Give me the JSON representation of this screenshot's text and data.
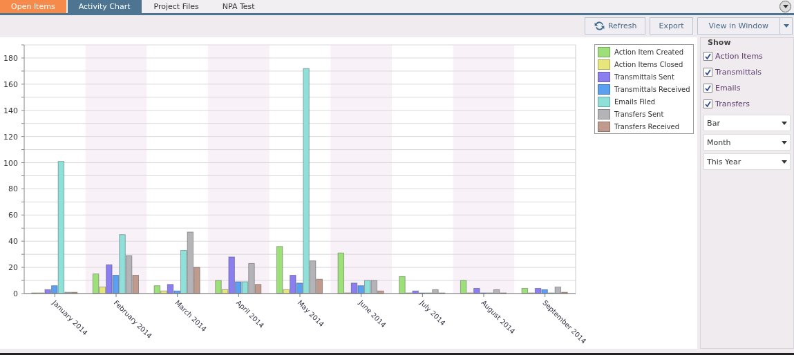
{
  "tabs": [
    {
      "label": "Open Items",
      "selected": false,
      "color": "#f58a4b"
    },
    {
      "label": "Activity Chart",
      "selected": true
    },
    {
      "label": "Project Files",
      "selected": false
    },
    {
      "label": "NPA Test",
      "selected": false
    }
  ],
  "toolbar": {
    "buttons": [
      {
        "label": "Refresh",
        "kind": "refresh"
      },
      {
        "label": "Export",
        "kind": "plain"
      },
      {
        "label": "View in Window",
        "kind": "split"
      }
    ]
  },
  "chart": {
    "chart_data": {
      "type": "bar",
      "grid": true,
      "categories": [
        "January 2014",
        "February 2014",
        "March 2014",
        "April 2014",
        "May 2014",
        "June 2014",
        "July 2014",
        "August 2014",
        "September 2014"
      ],
      "ylim": [
        0,
        190
      ],
      "yticks": [
        0,
        20,
        40,
        60,
        80,
        100,
        120,
        140,
        160,
        180
      ],
      "series": [
        {
          "name": "Action Item Created",
          "color": "#9de07a",
          "values": [
            0,
            15,
            6,
            10,
            36,
            31,
            13,
            10,
            4
          ]
        },
        {
          "name": "Action Items Closed",
          "color": "#e6e67a",
          "values": [
            0,
            5,
            2,
            3,
            3,
            0,
            0,
            0,
            0
          ]
        },
        {
          "name": "Transmittals Sent",
          "color": "#8b7ff0",
          "values": [
            3,
            22,
            7,
            28,
            14,
            8,
            2,
            4,
            4
          ]
        },
        {
          "name": "Transmittals Received",
          "color": "#5a9ff0",
          "values": [
            6,
            14,
            2,
            9,
            8,
            6,
            0,
            0,
            3
          ]
        },
        {
          "name": "Emails Filed",
          "color": "#8fe0d8",
          "values": [
            101,
            45,
            33,
            9,
            172,
            10,
            0,
            0,
            0
          ]
        },
        {
          "name": "Transfers Sent",
          "color": "#b4b4b8",
          "values": [
            1,
            29,
            47,
            23,
            25,
            10,
            3,
            3,
            5
          ]
        },
        {
          "name": "Transfers Received",
          "color": "#c09a8c",
          "values": [
            1,
            14,
            20,
            7,
            11,
            2,
            0,
            0,
            1
          ]
        }
      ]
    }
  },
  "show_panel": {
    "title": "Show",
    "checkboxes": [
      {
        "label": "Action Items",
        "checked": true
      },
      {
        "label": "Transmittals",
        "checked": true
      },
      {
        "label": "Emails",
        "checked": true
      },
      {
        "label": "Transfers",
        "checked": true
      }
    ],
    "dropdowns": [
      {
        "value": "Bar"
      },
      {
        "value": "Month"
      },
      {
        "value": "This Year"
      }
    ]
  }
}
